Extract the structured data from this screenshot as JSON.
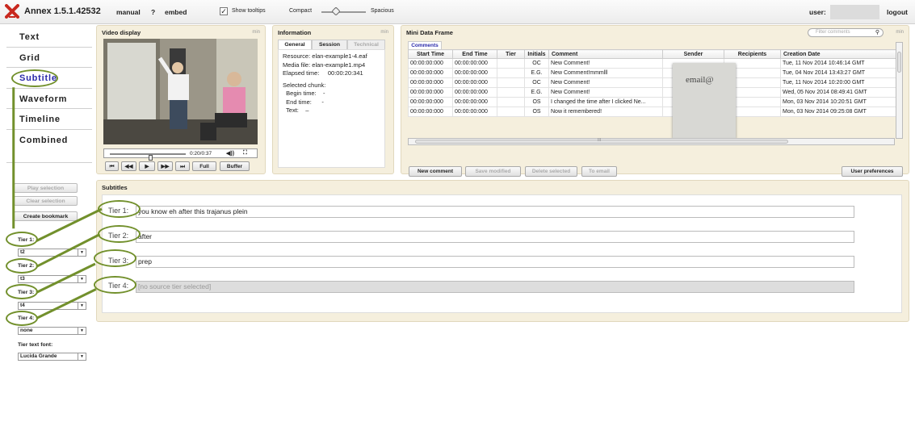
{
  "app": {
    "title": "Annex 1.5.1.42532",
    "manual": "manual",
    "help": "?",
    "embed": "embed"
  },
  "topbar": {
    "show_tooltips": "Show tooltips",
    "checkmark": "✓",
    "compact": "Compact",
    "spacious": "Spacious",
    "user_label": "user:",
    "logout": "logout"
  },
  "nav": {
    "items": [
      "Text",
      "Grid",
      "Subtitle",
      "Waveform",
      "Timeline",
      "Combined"
    ],
    "active": "Subtitle"
  },
  "controls": {
    "play_selection": "Play selection",
    "clear_selection": "Clear selection",
    "create_bookmark": "Create bookmark",
    "tier1_label": "Tier 1:",
    "tier1_value": "t2",
    "tier2_label": "Tier 2:",
    "tier2_value": "t3",
    "tier3_label": "Tier 3:",
    "tier3_value": "t4",
    "tier4_label": "Tier 4:",
    "tier4_value": "none",
    "font_label": "Tier text font:",
    "font_value": "Lucida Grande"
  },
  "video": {
    "title": "Video display",
    "min": "min",
    "time": "0:20/0:37",
    "progress": 0.54,
    "buttons": [
      "⏮",
      "◀◀",
      "▶",
      "▶▶",
      "⏭",
      "Full",
      "Buffer"
    ]
  },
  "information": {
    "title": "Information",
    "min": "min",
    "tabs": [
      "General",
      "Session",
      "Technical"
    ],
    "active_tab": "General",
    "resource_label": "Resource:",
    "resource": "elan-example1-4.eaf",
    "media_label": "Media file:",
    "media": "elan-example1.mp4",
    "elapsed_label": "Elapsed time:",
    "elapsed": "00:00:20:341",
    "chunk_label": "Selected chunk:",
    "begin_label": "Begin time:",
    "begin": "-",
    "end_label": "End time:",
    "end": "-",
    "text_label": "Text:",
    "text": "–"
  },
  "mdf": {
    "title": "Mini Data Frame",
    "min": "min",
    "filter_placeholder": "Filter comments",
    "tab": "Comments",
    "columns": [
      "Start Time",
      "End Time",
      "Tier",
      "Initials",
      "Comment",
      "Sender",
      "Recipients",
      "Creation Date"
    ],
    "rows": [
      [
        "00:00:00:000",
        "00:00:00:000",
        "",
        "OC",
        "New Comment!",
        "",
        "",
        "Tue, 11 Nov 2014 10:46:14 GMT"
      ],
      [
        "00:00:00:000",
        "00:00:00:000",
        "",
        "E.G.",
        "New Comment!mmmlll",
        "",
        "",
        "Tue, 04 Nov 2014 13:43:27 GMT"
      ],
      [
        "00:00:00:000",
        "00:00:00:000",
        "",
        "OC",
        "New Comment!",
        "",
        "",
        "Tue, 11 Nov 2014 10:20:00 GMT"
      ],
      [
        "00:00:00:000",
        "00:00:00:000",
        "",
        "E.G.",
        "New Comment!",
        "",
        "",
        "Wed, 05 Nov 2014 08:49:41 GMT"
      ],
      [
        "00:00:00:000",
        "00:00:00:000",
        "",
        "OS",
        "I changed the time after I clicked Ne...",
        "",
        "",
        "Mon, 03 Nov 2014 10:20:51 GMT"
      ],
      [
        "00:00:00:000",
        "00:00:00:000",
        "",
        "OS",
        "Now it remembered!",
        "",
        "",
        "Mon, 03 Nov 2014 09:25:08 GMT"
      ]
    ],
    "sender_overlay": "email@",
    "scroll_marker": "III",
    "buttons": [
      "New comment",
      "Save modified",
      "Delete selected",
      "To email"
    ],
    "user_preferences": "User preferences"
  },
  "subtitles": {
    "title": "Subtitles",
    "tiers": [
      {
        "label": "Tier 1:",
        "text": "you know eh after this trajanus plein"
      },
      {
        "label": "Tier 2:",
        "text": "after"
      },
      {
        "label": "Tier 3:",
        "text": "prep"
      },
      {
        "label": "Tier 4:",
        "text": "[no source tier selected]"
      }
    ]
  },
  "colors": {
    "panel": "#f5efdd",
    "accent": "#72902c",
    "active_nav": "#2a2aaa",
    "logo": "#c8281e"
  }
}
